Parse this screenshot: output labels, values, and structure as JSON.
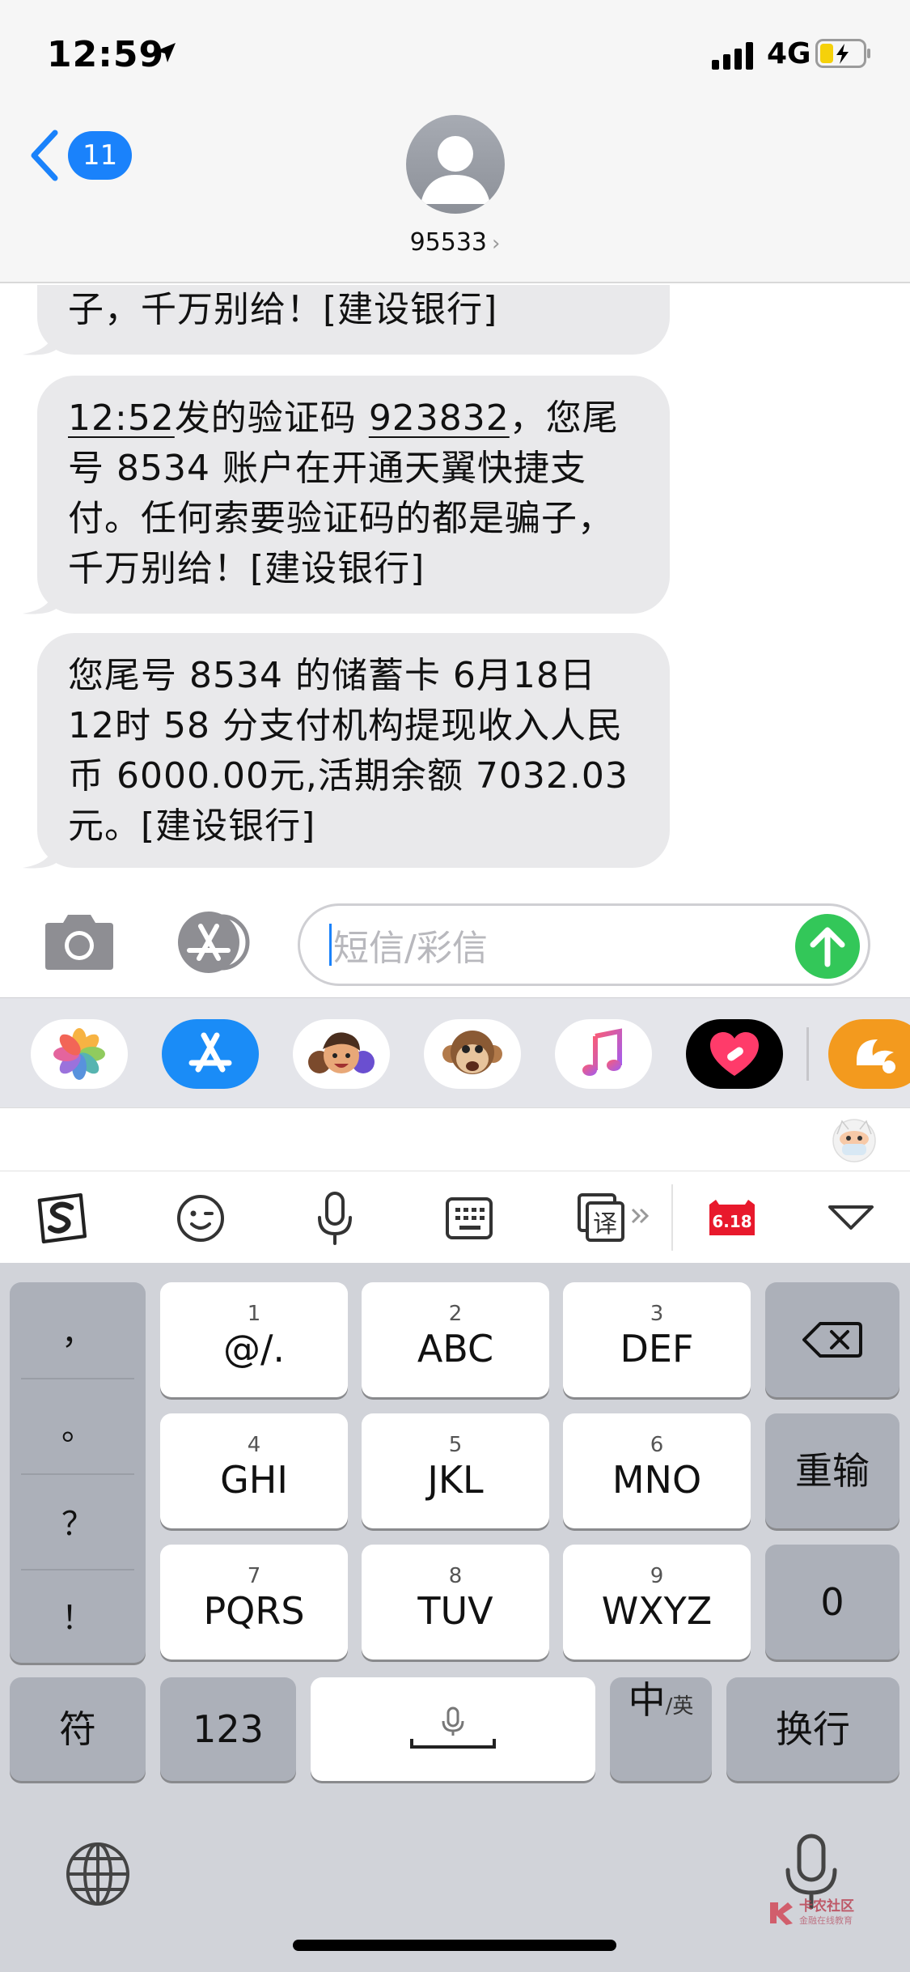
{
  "status_bar": {
    "time": "12:59",
    "network": "4G"
  },
  "header": {
    "back_count": "11",
    "contact": "95533",
    "chevron": "›"
  },
  "messages": [
    {
      "text": "子，千万别给！[建设银行]"
    },
    {
      "time_link": "12:52",
      "line1_rest": "发的验证码 ",
      "code": "923832",
      "line1_end": "，您",
      "rest": "尾号 8534 账户在开通天翼快捷支付。任何索要验证码的都是骗子，千万别给！[建设银行]"
    },
    {
      "text": "您尾号 8534 的储蓄卡 6月18日 12时 58 分支付机构提现收入人民币 6000.00元,活期余额 7032.03元。[建设银行]"
    }
  ],
  "compose": {
    "placeholder": "短信/彩信"
  },
  "app_strip": {
    "apps": [
      "photos-icon",
      "app-store-icon",
      "memoji-icon",
      "animoji-monkey-icon",
      "music-icon",
      "heart-app-icon",
      "uc-browser-icon"
    ]
  },
  "keyboard": {
    "toolbar": [
      "sogou-logo-icon",
      "emoji-icon",
      "microphone-icon",
      "keyboard-icon",
      "translate-icon",
      "618-badge-icon",
      "collapse-keyboard-icon"
    ],
    "toolbar_618": "6.18",
    "toolbar_translate": "译",
    "punctuation": [
      "，",
      "。",
      "？",
      "！"
    ],
    "keys": [
      {
        "num": "1",
        "label": "@/."
      },
      {
        "num": "2",
        "label": "ABC"
      },
      {
        "num": "3",
        "label": "DEF"
      },
      {
        "num": "4",
        "label": "GHI"
      },
      {
        "num": "5",
        "label": "JKL"
      },
      {
        "num": "6",
        "label": "MNO"
      },
      {
        "num": "7",
        "label": "PQRS"
      },
      {
        "num": "8",
        "label": "TUV"
      },
      {
        "num": "9",
        "label": "WXYZ"
      }
    ],
    "reenter": "重输",
    "zero": "0",
    "symbols": "符",
    "numbers": "123",
    "lang_main": "中",
    "lang_sub": "/英",
    "return": "换行"
  },
  "watermark": {
    "title": "卡农社区",
    "subtitle": "金融在线教育"
  },
  "colors": {
    "accent_blue": "#1a82fb",
    "send_green": "#33c759",
    "bubble_gray": "#e9e9eb",
    "keyboard_bg": "#d1d3d9"
  }
}
